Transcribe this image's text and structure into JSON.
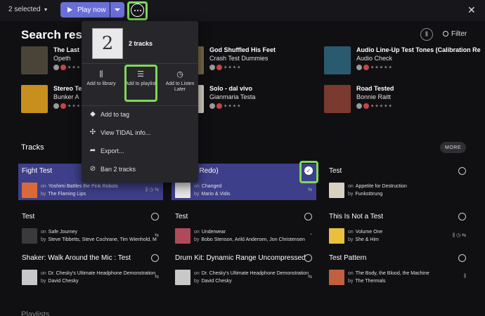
{
  "topbar": {
    "selected_label": "2 selected",
    "play_label": "Play now"
  },
  "header": {
    "title": "Search results",
    "filter_label": "Filter"
  },
  "albums": [
    {
      "title": "The Last",
      "artist": "Opeth",
      "stars": "★★★★★",
      "color": "#4a4438"
    },
    {
      "title": "God Shuffled His Feet",
      "artist": "Crash Test Dummies",
      "stars": "★★★★",
      "color": "#7a6a4a"
    },
    {
      "title": "Audio Line-Up Test Tones (Calibration Re",
      "artist": "Audio Check",
      "stars": "★★★★★",
      "color": "#2a5a70"
    },
    {
      "title": "Stereo Te",
      "artist": "Bunker A",
      "stars": "★★★★",
      "color": "#c7901e"
    },
    {
      "title": "Solo - dal vivo",
      "artist": "Gianmaria Testa",
      "stars": "★★★★",
      "color": "#d8d2c8"
    },
    {
      "title": "Road Tested",
      "artist": "Bonnie Raitt",
      "stars": "★★★★★",
      "color": "#7a3a30"
    }
  ],
  "popup": {
    "cover_number": "2",
    "count_label": "2 tracks",
    "actions": [
      {
        "label": "Add to library",
        "icon": "library-icon",
        "glyph": "⫼"
      },
      {
        "label": "Add to playlist",
        "icon": "playlist-add-icon",
        "glyph": "☰"
      },
      {
        "label": "Add to Listen Later",
        "icon": "clock-icon",
        "glyph": "◷"
      }
    ],
    "items": [
      {
        "label": "Add to tag",
        "icon": "tag-icon",
        "glyph": "◆"
      },
      {
        "label": "View TIDAL info...",
        "icon": "tidal-icon",
        "glyph": "✣"
      },
      {
        "label": "Export...",
        "icon": "export-icon",
        "glyph": "➦"
      },
      {
        "label": "Ban 2 tracks",
        "icon": "ban-icon",
        "glyph": "⊘"
      }
    ]
  },
  "tracks_section": {
    "title": "Tracks",
    "more_label": "MORE"
  },
  "tracks": [
    {
      "title": "Fight Test",
      "album": "Yoshimi Battles the Pink Robots",
      "artist": "The Flaming Lips",
      "selected": true,
      "color": "#d86a3a",
      "icons": "⫼ ◷ ⇆"
    },
    {
      "title": "(Album Redo)",
      "album": "Changed",
      "artist": "Mario & Vidis",
      "selected": true,
      "color": "#e8e8e8",
      "icons": "⇆"
    },
    {
      "title": "Test",
      "album": "Appetite for Destruction",
      "artist": "Funkstörung",
      "selected": false,
      "color": "#d8d0c0",
      "icons": ""
    },
    {
      "title": "Test",
      "album": "Safe Journey",
      "artist": "Steve Tibbetts, Steve Cochrane, Tim Wienhold, M",
      "selected": false,
      "color": "#3a3a3a",
      "icons": "⇆"
    },
    {
      "title": "Test",
      "album": "Underwear",
      "artist": "Bobo Stenson, Arild Andersen, Jon Christensen",
      "selected": false,
      "color": "#b04a5a",
      "icons": "◔"
    },
    {
      "title": "This Is Not a Test",
      "album": "Volume One",
      "artist": "She & Him",
      "selected": false,
      "color": "#e8c040",
      "icons": "⫼ ◷ ⇆"
    },
    {
      "title": "Shaker: Walk Around the Mic : Test",
      "album": "Dr. Chesky's Ultimate Headphone Demonstration",
      "artist": "David Chesky",
      "selected": false,
      "color": "#c8c8c8",
      "icons": "⇆"
    },
    {
      "title": "Drum Kit: Dynamic Range Uncompressed",
      "album": "Dr. Chesky's Ultimate Headphone Demonstration",
      "artist": "David Chesky",
      "selected": false,
      "color": "#c8c8c8",
      "icons": "⇆"
    },
    {
      "title": "Test Pattern",
      "album": "The Body, the Blood, the Machine",
      "artist": "The Thermals",
      "selected": false,
      "color": "#c06040",
      "icons": "⫼"
    }
  ],
  "on_label": "on",
  "by_label": "by",
  "bottom_hint": "Playlists"
}
